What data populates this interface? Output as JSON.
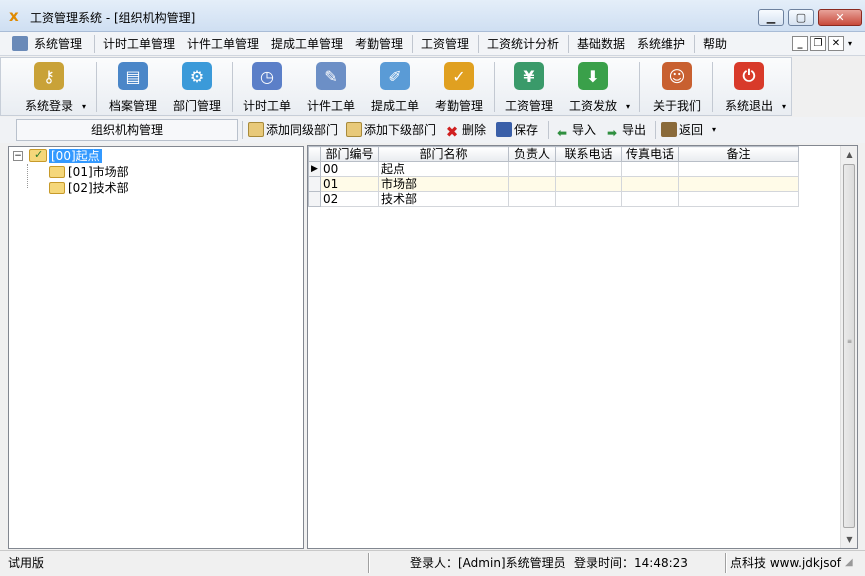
{
  "window": {
    "title": "工资管理系统 - [组织机构管理]"
  },
  "menu": [
    "系统管理",
    "计时工单管理",
    "计件工单管理",
    "提成工单管理",
    "考勤管理",
    "工资管理",
    "工资统计分析",
    "基础数据",
    "系统维护",
    "帮助"
  ],
  "toolbar": {
    "items": [
      {
        "label": "系统登录",
        "icon": "keys-icon",
        "color": "#c9a238"
      },
      {
        "label": "档案管理",
        "icon": "folder-user-icon",
        "color": "#4a86c8"
      },
      {
        "label": "部门管理",
        "icon": "folder-gear-icon",
        "color": "#3b9ad9"
      },
      {
        "label": "计时工单",
        "icon": "clock-sheet-icon",
        "color": "#5b7fc8"
      },
      {
        "label": "计件工单",
        "icon": "tools-sheet-icon",
        "color": "#6c8fc6"
      },
      {
        "label": "提成工单",
        "icon": "pen-sheet-icon",
        "color": "#5a9bd6"
      },
      {
        "label": "考勤管理",
        "icon": "attendance-icon",
        "color": "#e0a020"
      },
      {
        "label": "工资管理",
        "icon": "book-money-icon",
        "color": "#3a9a6a"
      },
      {
        "label": "工资发放",
        "icon": "download-money-icon",
        "color": "#3aa04a"
      },
      {
        "label": "关于我们",
        "icon": "people-icon",
        "color": "#c86030"
      },
      {
        "label": "系统退出",
        "icon": "power-icon",
        "color": "#d83a2a"
      }
    ]
  },
  "actionbar": {
    "section_label": "组织机构管理",
    "buttons": [
      {
        "label": "添加同级部门",
        "icon": "add-sibling-icon"
      },
      {
        "label": "添加下级部门",
        "icon": "add-child-icon"
      },
      {
        "label": "删除",
        "icon": "delete-x-icon"
      },
      {
        "label": "保存",
        "icon": "save-disk-icon"
      },
      {
        "label": "导入",
        "icon": "import-arrow-icon"
      },
      {
        "label": "导出",
        "icon": "export-arrow-icon"
      },
      {
        "label": "返回",
        "icon": "return-door-icon"
      }
    ]
  },
  "tree": {
    "root": "[00]起点",
    "children": [
      "[01]市场部",
      "[02]技术部"
    ]
  },
  "grid": {
    "columns": [
      "部门编号",
      "部门名称",
      "负责人",
      "联系电话",
      "传真电话",
      "备注"
    ],
    "rows": [
      [
        "00",
        "起点",
        "",
        "",
        "",
        ""
      ],
      [
        "01",
        "市场部",
        "",
        "",
        "",
        ""
      ],
      [
        "02",
        "技术部",
        "",
        "",
        "",
        ""
      ]
    ]
  },
  "status": {
    "edition": "试用版",
    "user": "登录人：[Admin]系统管理员",
    "login_time": "登录时间：14:48:23",
    "company": "点科技  www.jdkjsof"
  }
}
